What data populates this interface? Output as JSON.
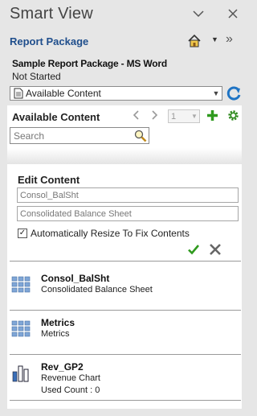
{
  "header": {
    "title": "Smart View",
    "minimize_glyph": "∨",
    "close_glyph": "✕"
  },
  "report_package": {
    "label": "Report Package",
    "home_icon": "home-icon",
    "more_glyph": "»"
  },
  "package": {
    "name": "Sample Report Package - MS Word",
    "status": "Not Started"
  },
  "view_select": {
    "selected": "Available Content",
    "icon": "document-icon"
  },
  "available_content": {
    "title": "Available Content",
    "page": "1",
    "search_placeholder": "Search"
  },
  "edit_content": {
    "title": "Edit Content",
    "name_value": "Consol_BalSht",
    "description_value": "Consolidated Balance Sheet",
    "auto_resize_label": "Automatically Resize To Fix Contents",
    "auto_resize_checked": true
  },
  "content_items": [
    {
      "name": "Consol_BalSht",
      "description": "Consolidated Balance Sheet",
      "used": "",
      "icon": "grid-icon"
    },
    {
      "name": "Metrics",
      "description": "Metrics",
      "used": "",
      "icon": "grid-icon"
    },
    {
      "name": "Rev_GP2",
      "description": "Revenue Chart",
      "used": "Used Count : 0",
      "icon": "chart-icon"
    }
  ],
  "colors": {
    "accent_blue": "#1f4e8c",
    "ok_green": "#2f9a1e",
    "panel_bg": "#ffffff",
    "app_bg": "#e6e6e6"
  }
}
